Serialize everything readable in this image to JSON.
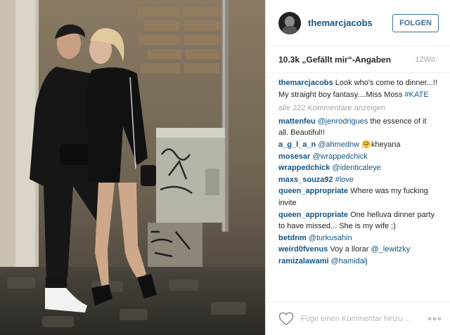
{
  "post": {
    "photo_alt": "",
    "username": "themarcjacobs",
    "follow_label": "FOLGEN",
    "likes": "10.3k „Gefällt mir“-Angaben",
    "age": "12Wo.",
    "caption": {
      "user": "themarcjacobs",
      "text": "Look who's come to dinner...!! My straight boy fantasy....Miss Moss",
      "hashtag": "#KATE"
    },
    "view_all": "alle 222 Kommentare anzeigen",
    "comments": [
      {
        "user": "mattenfeu",
        "mention": "@jenrodrigues",
        "text": "the essence of it all. Beautiful!!"
      },
      {
        "user": "a_g_l_a_n",
        "mention": "@ahmednw",
        "text": "🤗kheyana"
      },
      {
        "user": "mosesar",
        "mention": "@wrappedchick",
        "text": ""
      },
      {
        "user": "wrappedchick",
        "mention": "@identicaleye",
        "text": ""
      },
      {
        "user": "maxs_souza92",
        "mention": "#love",
        "text": ""
      },
      {
        "user": "queen_appropriate",
        "mention": "",
        "text": "Where was my fucking invite"
      },
      {
        "user": "queen_appropriate",
        "mention": "",
        "text": "One helluva dinner party to have missed... She is my wife ;)"
      },
      {
        "user": "betdnm",
        "mention": "@turkusahin",
        "text": ""
      },
      {
        "user": "weird0fvenus",
        "mention": "",
        "text": "Voy a llorar",
        "mention_after": "@_lewitzky"
      },
      {
        "user": "ramizalawami",
        "mention": "@hamidalj",
        "text": ""
      }
    ],
    "comment_placeholder": "Füge einen Kommentar hinzu ...",
    "icons": {
      "like": "heart-icon",
      "more": "more-options-icon"
    }
  }
}
